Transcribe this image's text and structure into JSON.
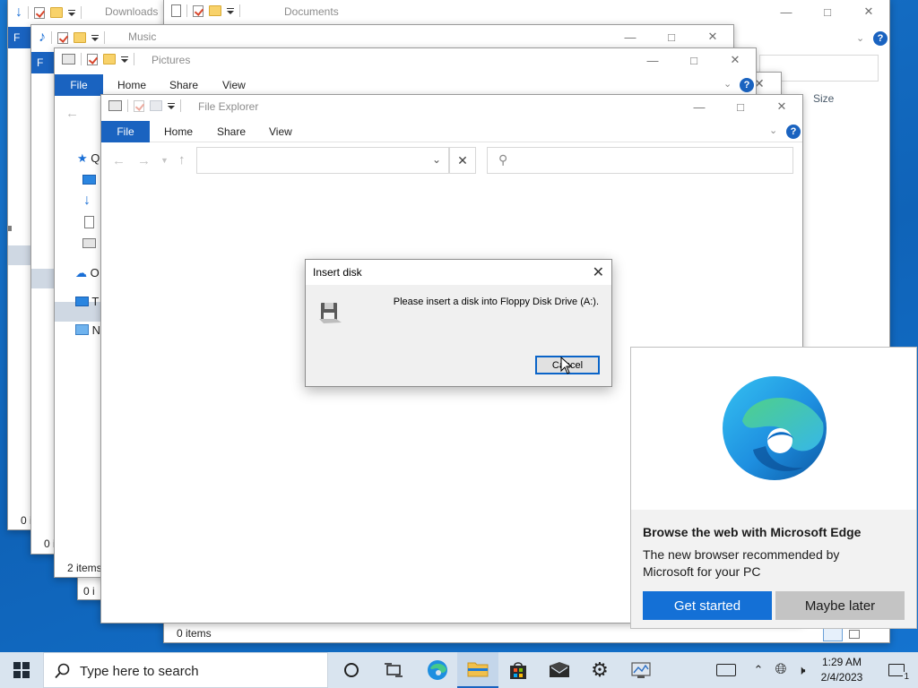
{
  "windows": {
    "downloads": {
      "title": "Downloads",
      "status": "0 i",
      "nav_letter": "F"
    },
    "documents": {
      "title": "Documents",
      "column_size": "Size",
      "status": "0 items"
    },
    "music": {
      "title": "Music",
      "status": "0 i",
      "nav_letter": "F"
    },
    "pictures": {
      "title": "Pictures",
      "status": "2 items",
      "tabs": {
        "file": "File",
        "home": "Home",
        "share": "Share",
        "view": "View"
      }
    },
    "back4": {
      "status": "0 i"
    },
    "explorer": {
      "title": "File Explorer",
      "tabs": {
        "file": "File",
        "home": "Home",
        "share": "Share",
        "view": "View"
      },
      "nav_items": [
        "Q",
        "O",
        "T",
        "N"
      ],
      "status": "0 items"
    }
  },
  "dialog": {
    "title": "Insert disk",
    "message": "Please insert a disk into Floppy Disk Drive (A:).",
    "cancel_label": "Cancel"
  },
  "edge_card": {
    "heading": "Browse the web with Microsoft Edge",
    "body": "The new browser recommended by Microsoft for your PC",
    "primary_label": "Get started",
    "secondary_label": "Maybe later"
  },
  "taskbar": {
    "search_placeholder": "Type here to search",
    "time": "1:29 AM",
    "date": "2/4/2023",
    "notification_count": "1"
  },
  "colors": {
    "accent": "#1a63c0",
    "edge_primary": "#1470d6",
    "desktop": "#0f6fc6"
  }
}
